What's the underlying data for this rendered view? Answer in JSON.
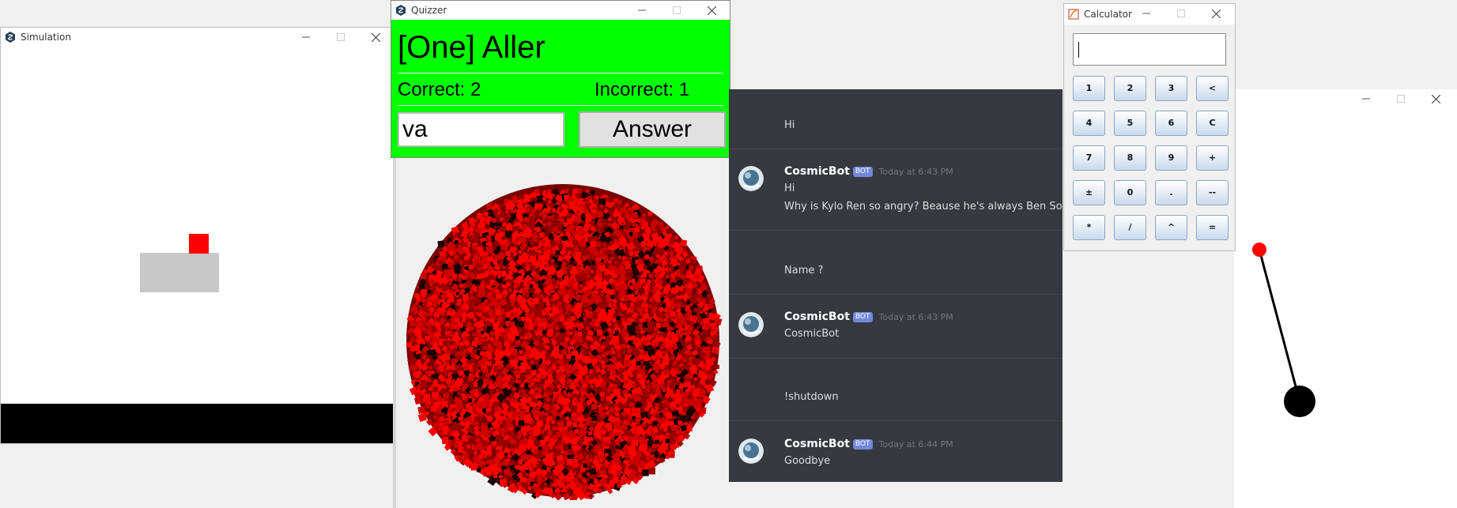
{
  "simulation": {
    "title": "Simulation"
  },
  "quizzer": {
    "title": "Quizzer",
    "prompt_word": "[One] Aller",
    "correct_label": "Correct: 2",
    "incorrect_label": "Incorrect: 1",
    "answer_value": "va",
    "answer_button": "Answer",
    "colors": {
      "background": "#00ff00"
    }
  },
  "particle_ball": {
    "colors": [
      "#ff0000",
      "#cc0000",
      "#990000",
      "#1a0000"
    ]
  },
  "discord": {
    "colors": {
      "background": "#36393f",
      "bot_tag": "#7289da"
    },
    "messages": [
      {
        "type": "plain",
        "text": "Hi"
      },
      {
        "type": "bot",
        "author": "CosmicBot",
        "tag": "BOT",
        "time": "Today at 6:43 PM",
        "lines": [
          "Hi",
          "Why is Kylo Ren so angry? Beause he's always Ben Solo."
        ]
      },
      {
        "type": "plain",
        "text": "Name ?"
      },
      {
        "type": "bot",
        "author": "CosmicBot",
        "tag": "BOT",
        "time": "Today at 6:43 PM",
        "lines": [
          "CosmicBot"
        ]
      },
      {
        "type": "plain",
        "text": "!shutdown"
      },
      {
        "type": "bot",
        "author": "CosmicBot",
        "tag": "BOT",
        "time": "Today at 6:44 PM",
        "lines": [
          "Goodbye"
        ]
      }
    ]
  },
  "calculator": {
    "title": "Calculator",
    "display_value": "",
    "buttons": [
      "1",
      "2",
      "3",
      "<",
      "4",
      "5",
      "6",
      "C",
      "7",
      "8",
      "9",
      "+",
      "±",
      "0",
      ".",
      "--",
      "*",
      "/",
      "^",
      "="
    ]
  },
  "pendulum": {
    "colors": {
      "pivot": "#ff0000",
      "bob": "#000000"
    }
  }
}
